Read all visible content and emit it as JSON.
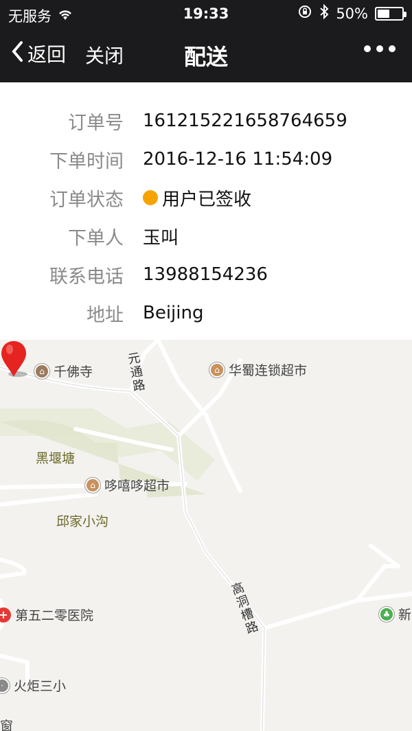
{
  "status_bar": {
    "carrier": "无服务",
    "time": "19:33",
    "battery_text": "50%",
    "battery_level": 0.5,
    "icons": [
      "wifi-icon",
      "rotation-lock-icon",
      "bluetooth-icon",
      "battery-icon"
    ]
  },
  "nav": {
    "back_label": "返回",
    "close_label": "关闭",
    "title": "配送",
    "more_icon": "more-dots-icon"
  },
  "order": {
    "fields": [
      {
        "label": "订单号",
        "value": "161215221658764659"
      },
      {
        "label": "下单时间",
        "value": "2016-12-16 11:54:09"
      },
      {
        "label": "订单状态",
        "value": "用户已签收",
        "status_color": "#f6a300"
      },
      {
        "label": "下单人",
        "value": "玉叫"
      },
      {
        "label": "联系电话",
        "value": "13988154236"
      },
      {
        "label": "地址",
        "value": "Beijing"
      }
    ]
  },
  "map": {
    "pois": [
      {
        "name": "千佛寺",
        "icon": "temple-icon"
      },
      {
        "name": "华蜀连锁超市",
        "icon": "shop-icon"
      },
      {
        "name": "哆嘻哆超市",
        "icon": "shop-icon"
      },
      {
        "name": "第五二零医院",
        "icon": "hospital-icon"
      },
      {
        "name": "火炬三小",
        "icon": "school-icon"
      },
      {
        "name": "新",
        "icon": "park-icon"
      },
      {
        "name": "窗",
        "icon": "poi-icon"
      }
    ],
    "areas": [
      "黑堰塘",
      "邱家小沟"
    ],
    "roads": [
      "元通路",
      "高洞槽路"
    ],
    "pin_color": "#e52422"
  }
}
